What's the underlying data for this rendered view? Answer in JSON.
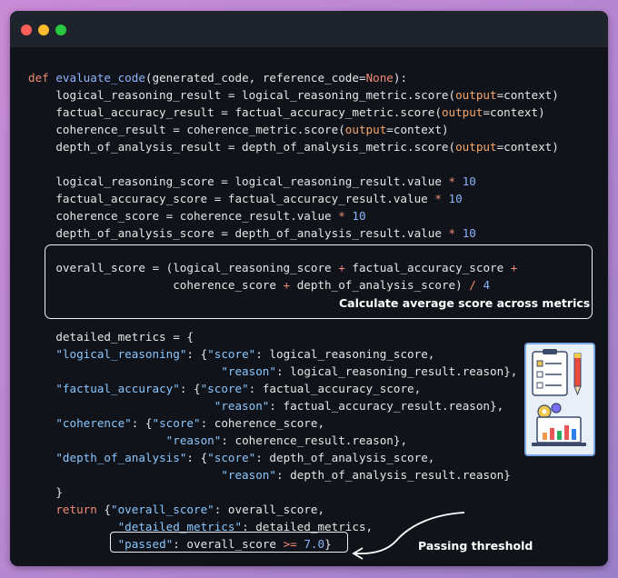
{
  "window": {
    "buttons": {
      "close": "close",
      "minimize": "minimize",
      "maximize": "maximize"
    },
    "colors": {
      "close": "#ff5f57",
      "minimize": "#febc2e",
      "maximize": "#28c840",
      "background": "#101319",
      "titlebar": "#1f232b"
    }
  },
  "code": {
    "lines": [
      [
        {
          "t": "def ",
          "c": "kw"
        },
        {
          "t": "evaluate_code",
          "c": "fn"
        },
        {
          "t": "(generated_code, reference_code="
        },
        {
          "t": "None",
          "c": "kw"
        },
        {
          "t": "):"
        }
      ],
      [
        {
          "t": "    logical_reasoning_result = logical_reasoning_metric.score("
        },
        {
          "t": "output",
          "c": "kwarg"
        },
        {
          "t": "=context)"
        }
      ],
      [
        {
          "t": "    factual_accuracy_result = factual_accuracy_metric.score("
        },
        {
          "t": "output",
          "c": "kwarg"
        },
        {
          "t": "=context)"
        }
      ],
      [
        {
          "t": "    coherence_result = coherence_metric.score("
        },
        {
          "t": "output",
          "c": "kwarg"
        },
        {
          "t": "=context)"
        }
      ],
      [
        {
          "t": "    depth_of_analysis_result = depth_of_analysis_metric.score("
        },
        {
          "t": "output",
          "c": "kwarg"
        },
        {
          "t": "=context)"
        }
      ],
      [],
      [
        {
          "t": "    logical_reasoning_score = logical_reasoning_result.value "
        },
        {
          "t": "*",
          "c": "op"
        },
        {
          "t": " "
        },
        {
          "t": "10",
          "c": "num"
        }
      ],
      [
        {
          "t": "    factual_accuracy_score = factual_accuracy_result.value "
        },
        {
          "t": "*",
          "c": "op"
        },
        {
          "t": " "
        },
        {
          "t": "10",
          "c": "num"
        }
      ],
      [
        {
          "t": "    coherence_score = coherence_result.value "
        },
        {
          "t": "*",
          "c": "op"
        },
        {
          "t": " "
        },
        {
          "t": "10",
          "c": "num"
        }
      ],
      [
        {
          "t": "    depth_of_analysis_score = depth_of_analysis_result.value "
        },
        {
          "t": "*",
          "c": "op"
        },
        {
          "t": " "
        },
        {
          "t": "10",
          "c": "num"
        }
      ],
      [],
      [
        {
          "t": "    overall_score = (logical_reasoning_score "
        },
        {
          "t": "+",
          "c": "op"
        },
        {
          "t": " factual_accuracy_score "
        },
        {
          "t": "+",
          "c": "op"
        }
      ],
      [
        {
          "t": "                     coherence_score "
        },
        {
          "t": "+",
          "c": "op"
        },
        {
          "t": " depth_of_analysis_score) "
        },
        {
          "t": "/",
          "c": "op"
        },
        {
          "t": " "
        },
        {
          "t": "4",
          "c": "num"
        }
      ],
      [],
      [],
      [
        {
          "t": "    detailed_metrics = {"
        }
      ],
      [
        {
          "t": "    "
        },
        {
          "t": "\"logical_reasoning\"",
          "c": "str"
        },
        {
          "t": ": {"
        },
        {
          "t": "\"score\"",
          "c": "str"
        },
        {
          "t": ": logical_reasoning_score,"
        }
      ],
      [
        {
          "t": "                            "
        },
        {
          "t": "\"reason\"",
          "c": "str"
        },
        {
          "t": ": logical_reasoning_result.reason},"
        }
      ],
      [
        {
          "t": "    "
        },
        {
          "t": "\"factual_accuracy\"",
          "c": "str"
        },
        {
          "t": ": {"
        },
        {
          "t": "\"score\"",
          "c": "str"
        },
        {
          "t": ": factual_accuracy_score,"
        }
      ],
      [
        {
          "t": "                           "
        },
        {
          "t": "\"reason\"",
          "c": "str"
        },
        {
          "t": ": factual_accuracy_result.reason},"
        }
      ],
      [
        {
          "t": "    "
        },
        {
          "t": "\"coherence\"",
          "c": "str"
        },
        {
          "t": ": {"
        },
        {
          "t": "\"score\"",
          "c": "str"
        },
        {
          "t": ": coherence_score,"
        }
      ],
      [
        {
          "t": "                    "
        },
        {
          "t": "\"reason\"",
          "c": "str"
        },
        {
          "t": ": coherence_result.reason},"
        }
      ],
      [
        {
          "t": "    "
        },
        {
          "t": "\"depth_of_analysis\"",
          "c": "str"
        },
        {
          "t": ": {"
        },
        {
          "t": "\"score\"",
          "c": "str"
        },
        {
          "t": ": depth_of_analysis_score,"
        }
      ],
      [
        {
          "t": "                            "
        },
        {
          "t": "\"reason\"",
          "c": "str"
        },
        {
          "t": ": depth_of_analysis_result.reason}"
        }
      ],
      [
        {
          "t": "    }"
        }
      ],
      [
        {
          "t": "    "
        },
        {
          "t": "return",
          "c": "kw"
        },
        {
          "t": " {"
        },
        {
          "t": "\"overall_score\"",
          "c": "str"
        },
        {
          "t": ": overall_score,"
        }
      ],
      [
        {
          "t": "             "
        },
        {
          "t": "\"detailed_metrics\"",
          "c": "str"
        },
        {
          "t": ": detailed_metrics,"
        }
      ],
      [
        {
          "t": "             "
        },
        {
          "t": "\"passed\"",
          "c": "str"
        },
        {
          "t": ": overall_score "
        },
        {
          "t": ">=",
          "c": "op"
        },
        {
          "t": " "
        },
        {
          "t": "7.0",
          "c": "num"
        },
        {
          "t": "}"
        }
      ]
    ]
  },
  "annotations": {
    "average": "Calculate average score across metrics",
    "threshold": "Passing threshold"
  },
  "illustration": {
    "icon": "report-chart-icon"
  }
}
